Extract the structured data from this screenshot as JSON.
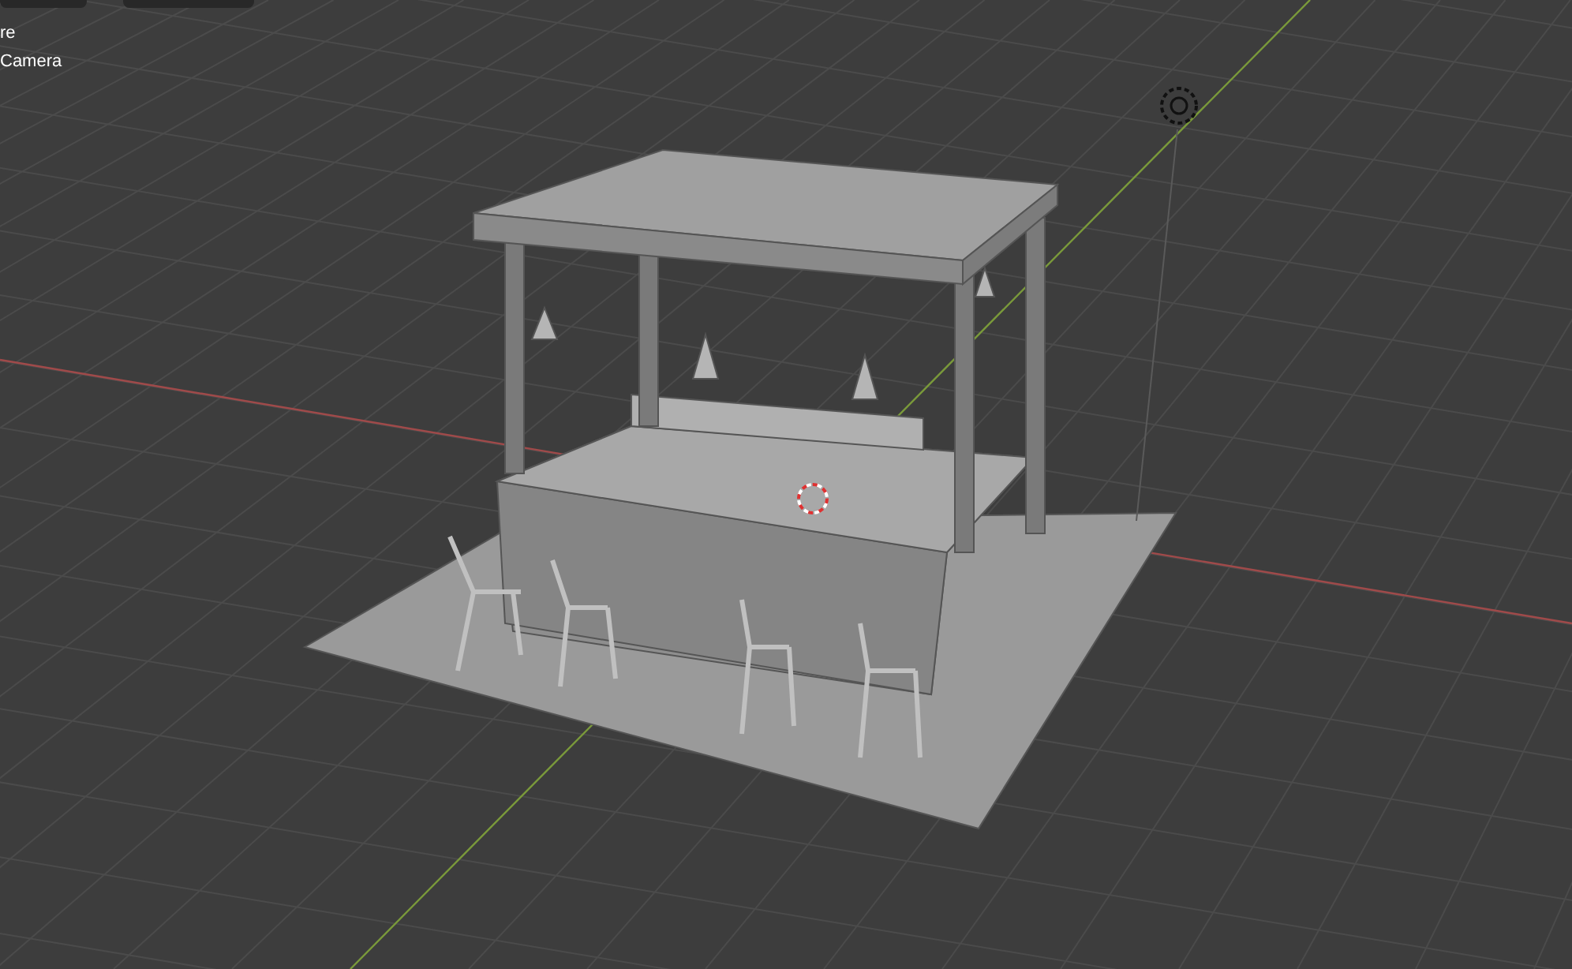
{
  "viewport": {
    "overlay_lines": [
      "re",
      "Camera"
    ]
  }
}
